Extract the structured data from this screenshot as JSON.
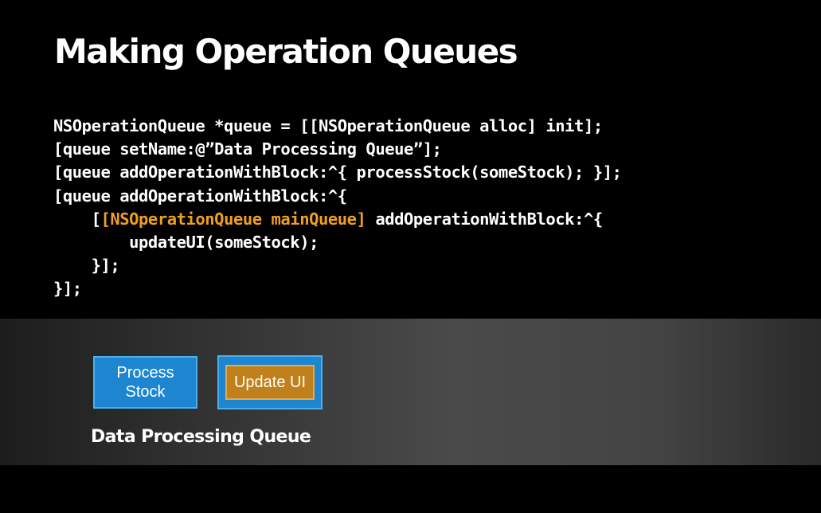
{
  "slide": {
    "title": "Making Operation Queues",
    "code_lines": [
      {
        "before": "NSOperationQueue *queue = [[NSOperationQueue alloc] init];",
        "highlight": "",
        "after": ""
      },
      {
        "before": "[queue setName:@”Data Processing Queue”];",
        "highlight": "",
        "after": ""
      },
      {
        "before": "[queue addOperationWithBlock:^{ processStock(someStock); }];",
        "highlight": "",
        "after": ""
      },
      {
        "before": "[queue addOperationWithBlock:^{",
        "highlight": "",
        "after": ""
      },
      {
        "before": "    [",
        "highlight": "[NSOperationQueue mainQueue]",
        "after": " addOperationWithBlock:^{"
      },
      {
        "before": "        updateUI(someStock);",
        "highlight": "",
        "after": ""
      },
      {
        "before": "    }];",
        "highlight": "",
        "after": ""
      },
      {
        "before": "}];",
        "highlight": "",
        "after": ""
      }
    ],
    "highlight_color": "#f0a020"
  },
  "diagram": {
    "operations": [
      {
        "label": "Process Stock",
        "color": "#1e86d0"
      },
      {
        "label": "Update UI",
        "color": "#c0801c"
      }
    ],
    "queue_label": "Data Processing Queue"
  }
}
